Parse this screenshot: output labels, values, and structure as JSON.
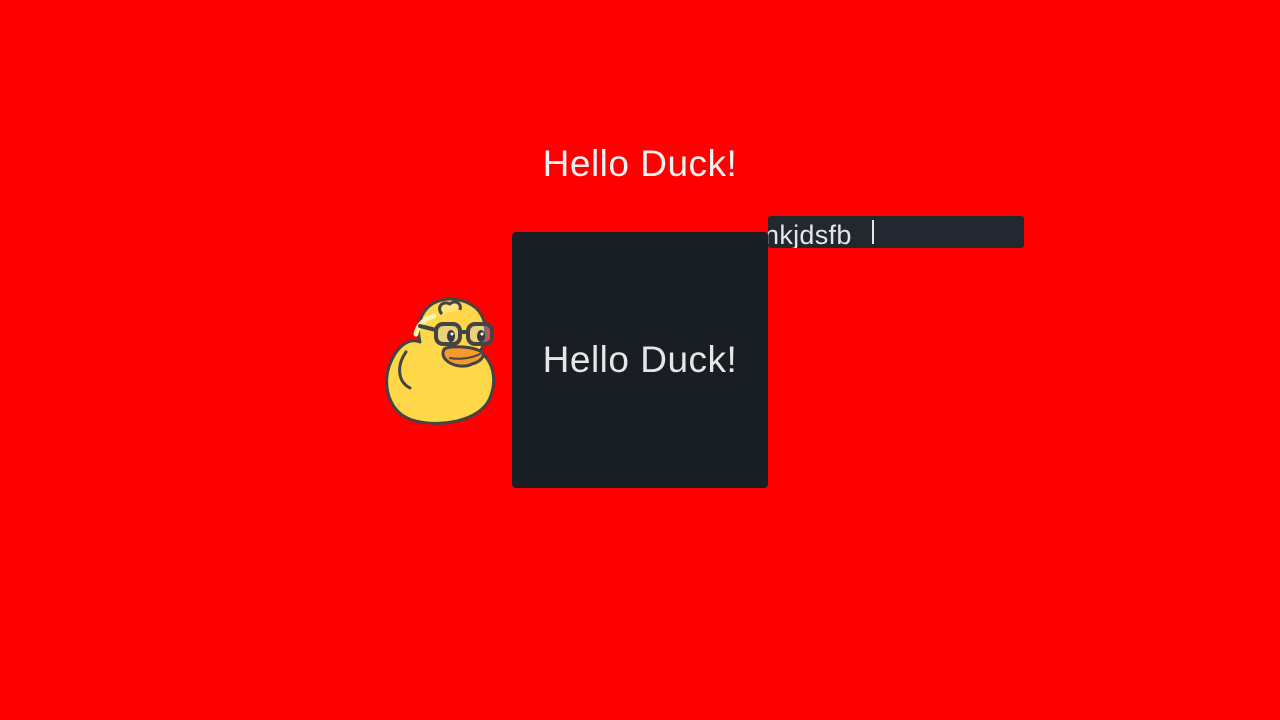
{
  "heading": {
    "text": "Hello Duck!"
  },
  "card": {
    "text": "Hello Duck!"
  },
  "text_field": {
    "value": "nkjdsfb"
  },
  "icons": {
    "mascot": "duck-with-glasses-icon"
  },
  "colors": {
    "background": "#ff0000",
    "card_background": "#181e24",
    "field_background": "#22282f",
    "text": "#e6e6e6",
    "duck_body": "#ffd84a"
  }
}
